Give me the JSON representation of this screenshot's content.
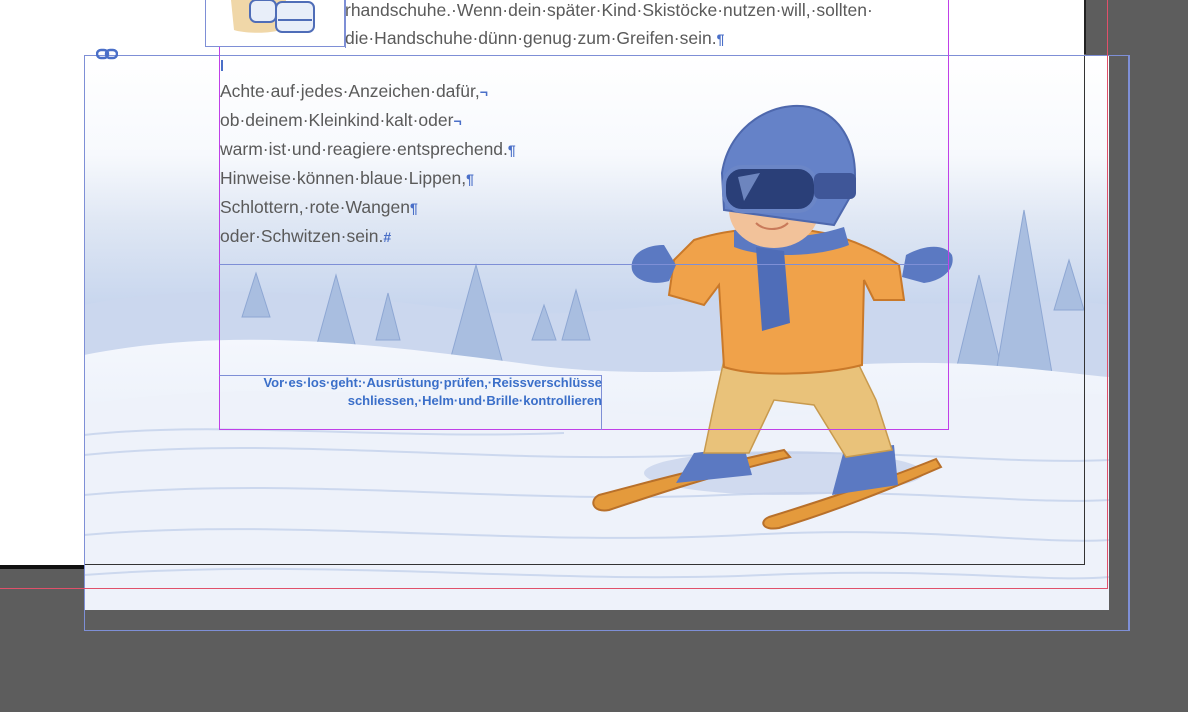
{
  "document": {
    "top_text": {
      "lines": [
        "rhandschuhe.·Wenn·dein·später·Kind·Skistöcke·nutzen·will,·sollten·",
        "die·Handschuhe·dünn·genug·zum·Greifen·sein."
      ],
      "end_mark": "¶"
    },
    "main_text": {
      "lines": [
        {
          "text": "Achte·auf·jedes·Anzeichen·dafür,",
          "mark": "¬"
        },
        {
          "text": "ob·deinem·Kleinkind·kalt·oder",
          "mark": "¬"
        },
        {
          "text": "warm·ist·und·reagiere·entsprechend.",
          "mark": "¶"
        },
        {
          "text": "Hinweise·können·blaue·Lippen,",
          "mark": "¶"
        },
        {
          "text": "Schlottern,·rote·Wangen",
          "mark": "¶"
        },
        {
          "text": "oder·Schwitzen·sein.",
          "mark": "#"
        }
      ]
    },
    "caption": {
      "line1": "Vor·es·los·geht:·Ausrüstung·prüfen,·Reissverschlüsse",
      "line2": "schliessen,·Helm·und·Brille·kontrollieren"
    },
    "icons": {
      "link": "chain-link-icon",
      "frame_marker": "frame-marker-icon"
    },
    "colors": {
      "pasteboard": "#5d5d5d",
      "frame_blue": "#7e8fd6",
      "margin_magenta": "#c040e8",
      "bleed_red": "#e0506a",
      "hidden_chars": "#4a6fc8"
    }
  }
}
